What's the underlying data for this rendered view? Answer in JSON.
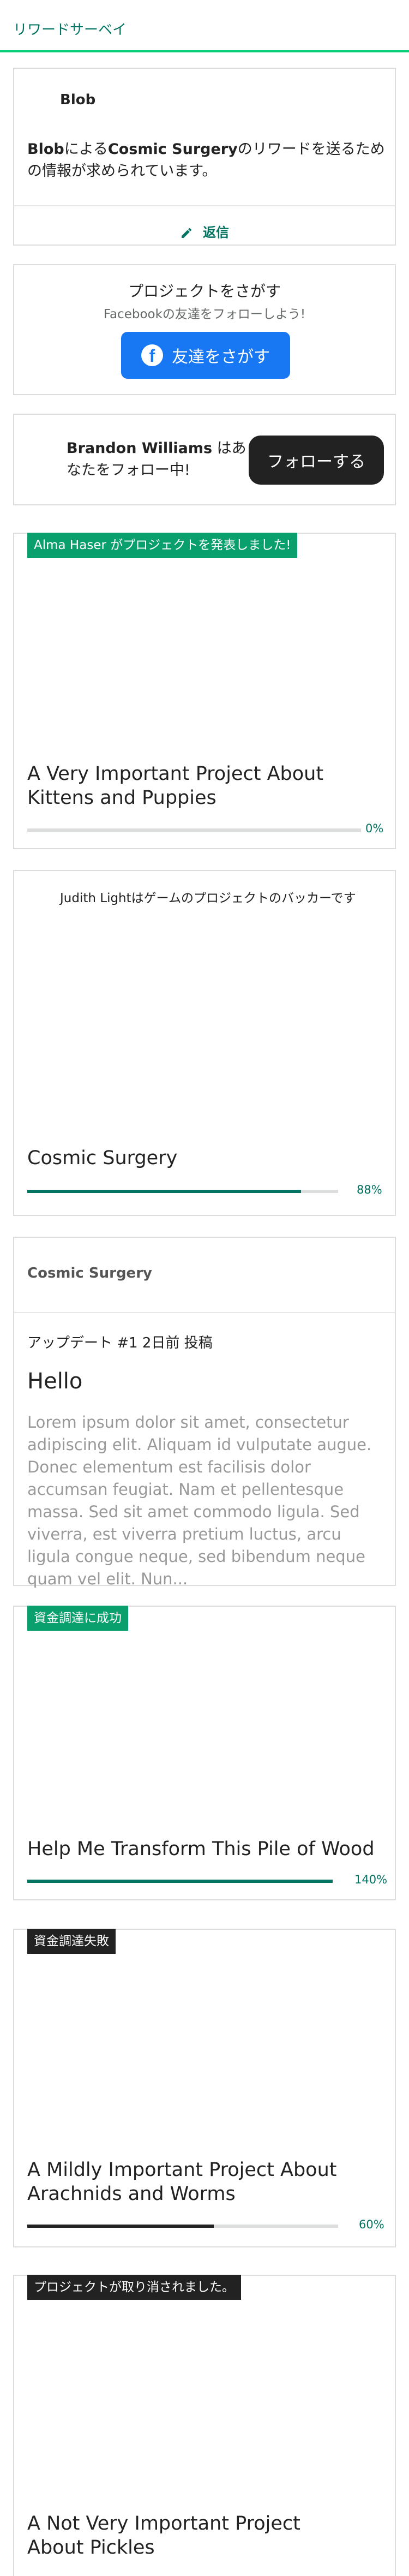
{
  "header": {
    "title": "リワードサーベイ"
  },
  "survey": {
    "creator": "Blob",
    "message_name": "Blob",
    "message_mid": "による",
    "message_project": "Cosmic Surgery",
    "message_end": "のリワードを送るための情報が求められています。",
    "reply_label": "返信",
    "reply_icon": "pencil-icon"
  },
  "find_friends": {
    "title": "プロジェクトをさがす",
    "subtitle": "Facebookの友達をフォローしよう!",
    "button_label": "友達をさがす",
    "button_icon": "facebook-icon"
  },
  "follow": {
    "name": "Brandon Williams",
    "text": " はあなたをフォロー中!",
    "button_label": "フォローする"
  },
  "project_launch": {
    "tag": "Alma Haser がプロジェクトを発表しました!",
    "title": "A Very Important Project About Kittens and Puppies",
    "percent": "0%",
    "progress": 0
  },
  "backing": {
    "text": "Judith Lightはゲームのプロジェクトのバッカーです",
    "title": "Cosmic Surgery",
    "percent": "88%",
    "progress": 0.88
  },
  "update": {
    "project": "Cosmic Surgery",
    "meta": "アップデート #1 2日前 投稿",
    "title": "Hello",
    "body": "Lorem ipsum dolor sit amet, consectetur adipiscing elit. Aliquam id vulputate augue. Donec elementum est facilisis dolor accumsan feugiat. Nam et pellentesque massa. Sed sit amet commodo ligula. Sed viverra, est viverra pretium luctus, arcu ligula congue neque, sed bibendum neque quam vel elit. Nun..."
  },
  "funded": {
    "tag": "資金調達に成功",
    "title": "Help Me Transform This Pile of Wood",
    "percent": "140%",
    "progress": 1.0
  },
  "failed": {
    "tag": "資金調達失敗",
    "title": "A Mildly Important Project About Arachnids and Worms",
    "percent": "60%",
    "progress": 0.6
  },
  "canceled": {
    "tag": "プロジェクトが取り消されました。",
    "title": "A Not Very Important Project About Pickles"
  },
  "colors": {
    "accent": "#037362",
    "success": "#05ce78",
    "dark": "#222222",
    "facebook": "#1877f2"
  }
}
